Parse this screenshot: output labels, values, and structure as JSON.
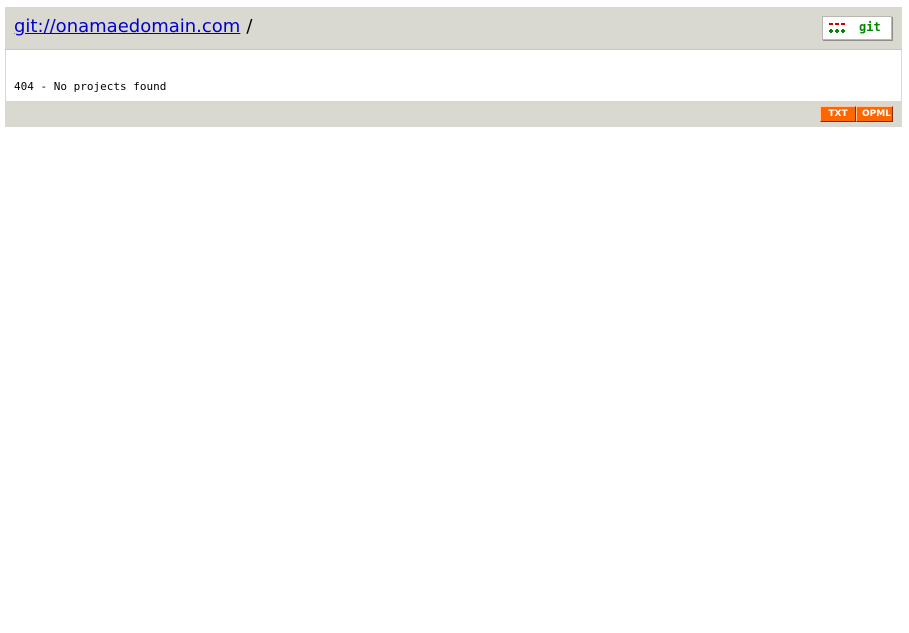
{
  "header": {
    "site_link": "git://onamaedomain.com",
    "separator": "/",
    "logo_text": "git",
    "logo_icon": "git-logo-icon"
  },
  "main": {
    "error_message": "404 - No projects found"
  },
  "footer": {
    "feeds": [
      {
        "label": "TXT"
      },
      {
        "label": "OPML"
      }
    ]
  },
  "colors": {
    "header_bg": "#d9d8d1",
    "link": "#0000cc",
    "feed_button": "#ff6600",
    "logo_minus": "#cc0000",
    "logo_plus": "#008800"
  }
}
